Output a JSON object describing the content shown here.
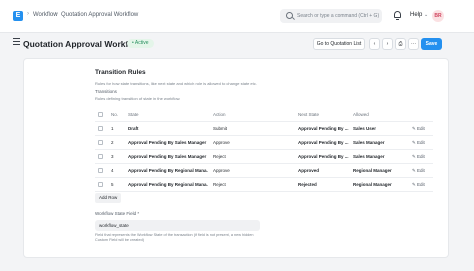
{
  "navbar": {
    "logo_letter": "E",
    "breadcrumbs": [
      "Workflow",
      "Quotation Approval Workflow"
    ],
    "search_placeholder": "Search or type a command (Ctrl + G)",
    "help_label": "Help",
    "avatar_initials": "BR"
  },
  "page": {
    "title": "Quotation Approval Workflow",
    "status": "Active",
    "go_to_label": "Go to Quotation List",
    "more_label": "···",
    "save_label": "Save"
  },
  "section": {
    "title": "Transition Rules",
    "description": "Rules for how state transitions, like next state and which role is allowed to change state etc.",
    "table_label": "Transitions",
    "table_sublabel": "Rules defining transition of state in the workflow."
  },
  "table": {
    "headers": [
      "No.",
      "State",
      "Action",
      "Next State",
      "Allowed",
      ""
    ],
    "rows": [
      {
        "no": "1",
        "state": "Draft",
        "action": "Submit",
        "next": "Approval Pending By ...",
        "allowed": "Sales User",
        "edit": "Edit"
      },
      {
        "no": "2",
        "state": "Approval Pending By Sales Manager",
        "action": "Approve",
        "next": "Approval Pending By ...",
        "allowed": "Sales Manager",
        "edit": "Edit"
      },
      {
        "no": "3",
        "state": "Approval Pending By Sales Manager",
        "action": "Reject",
        "next": "Approval Pending By ...",
        "allowed": "Sales Manager",
        "edit": "Edit"
      },
      {
        "no": "4",
        "state": "Approval Pending By Regional Mana...",
        "action": "Approve",
        "next": "Approved",
        "allowed": "Regional Manager",
        "edit": "Edit"
      },
      {
        "no": "5",
        "state": "Approval Pending By Regional Mana...",
        "action": "Reject",
        "next": "Rejected",
        "allowed": "Regional Manager",
        "edit": "Edit"
      }
    ],
    "add_row_label": "Add Row"
  },
  "field": {
    "label": "Workflow State Field *",
    "value": "workflow_state",
    "help": "Field that represents the Workflow State of the transaction (if field is not present, a new hidden Custom Field will be created)"
  },
  "colors": {
    "primary": "#2490ef",
    "active_badge_bg": "#e4f5e9",
    "active_badge_text": "#278f5e"
  }
}
